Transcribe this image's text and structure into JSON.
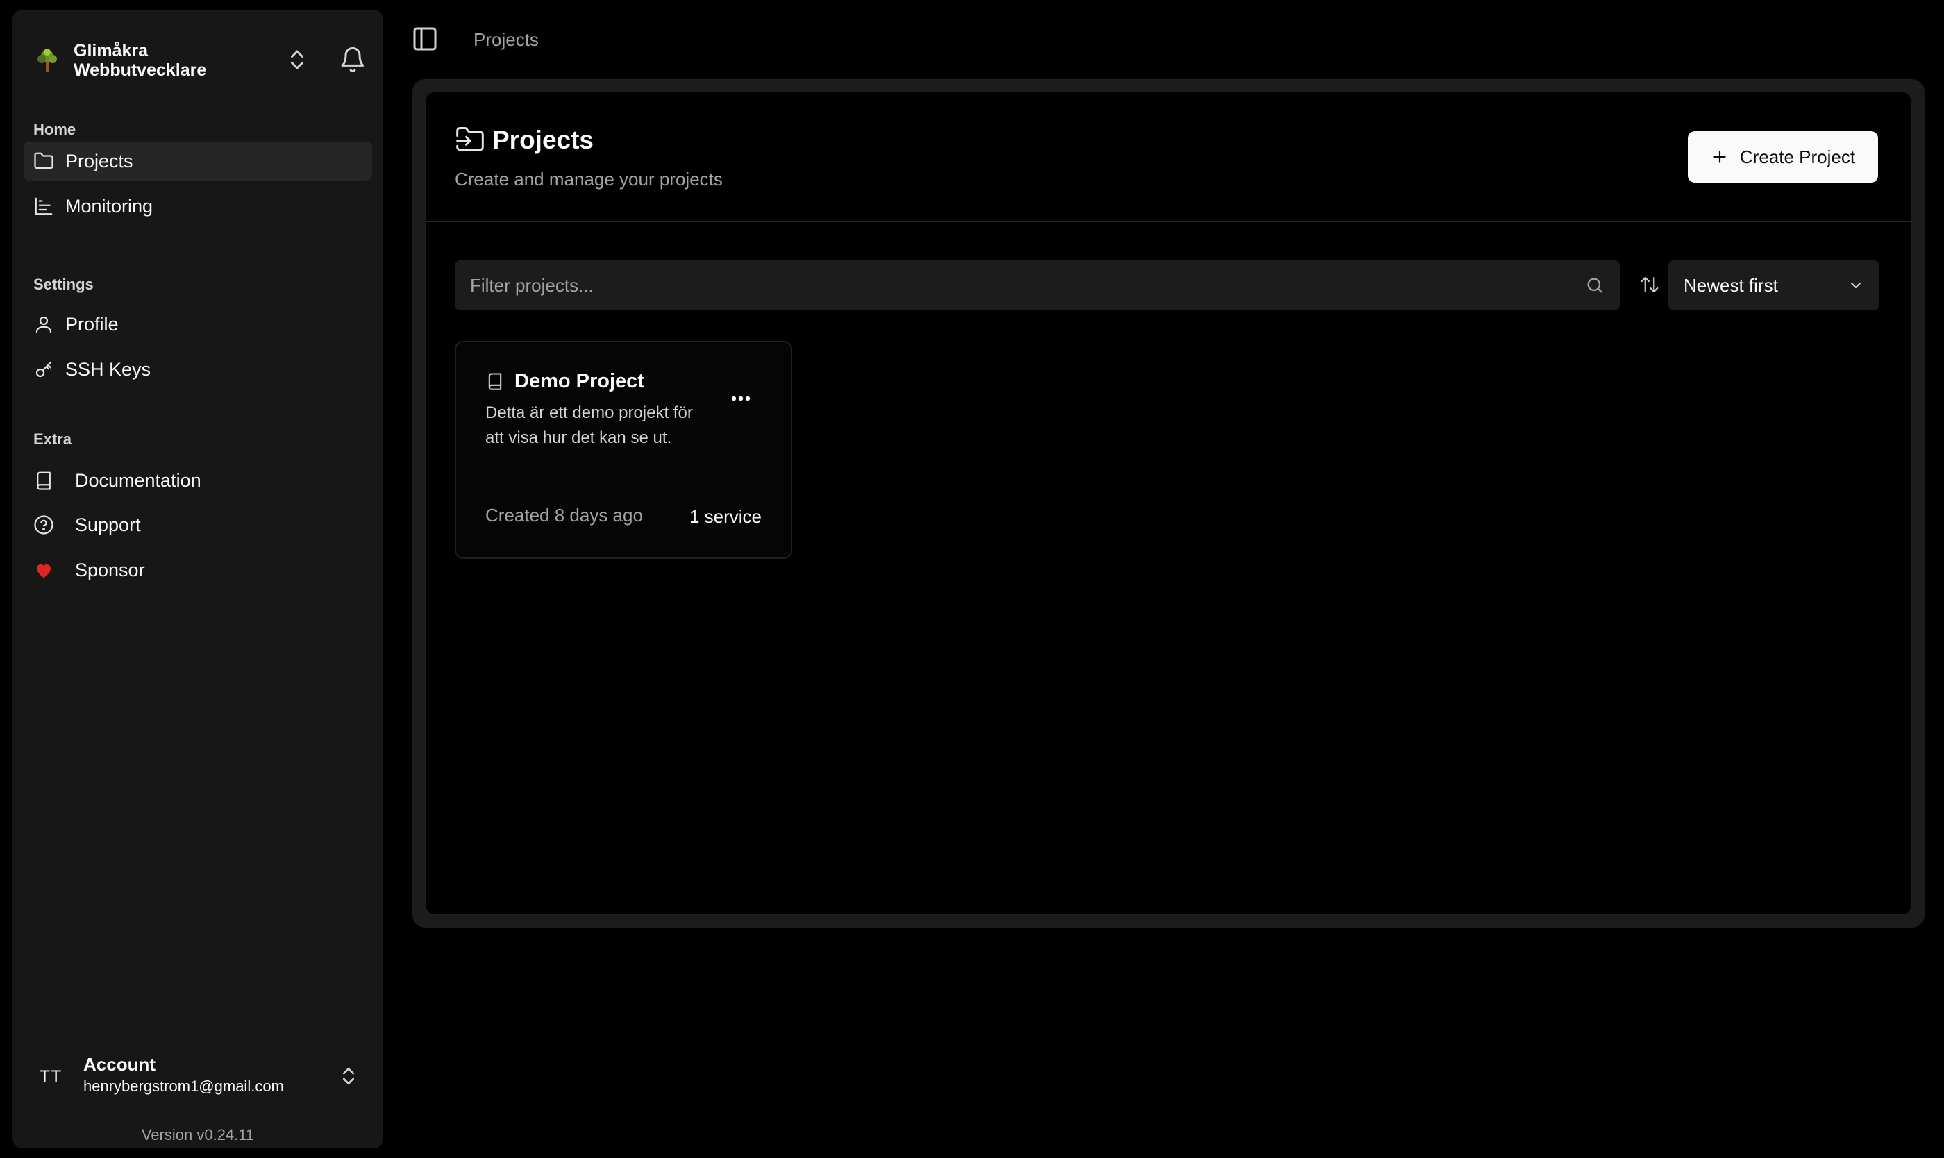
{
  "org": {
    "name": "Glimåkra Webbutvecklare"
  },
  "sidebar": {
    "groups": [
      {
        "label": "Home"
      },
      {
        "label": "Settings"
      },
      {
        "label": "Extra"
      }
    ],
    "items": [
      {
        "label": "Projects",
        "icon": "folder-icon",
        "active": true
      },
      {
        "label": "Monitoring",
        "icon": "monitoring-icon"
      },
      {
        "label": "Profile",
        "icon": "user-icon"
      },
      {
        "label": "SSH Keys",
        "icon": "key-icon"
      },
      {
        "label": "Documentation",
        "icon": "book-icon"
      },
      {
        "label": "Support",
        "icon": "help-circle-icon"
      },
      {
        "label": "Sponsor",
        "icon": "heart-icon",
        "color": "#dc2626"
      }
    ]
  },
  "account": {
    "initials": "TT",
    "label": "Account",
    "email": "henrybergstrom1@gmail.com"
  },
  "version": "Version v0.24.11",
  "breadcrumb": {
    "current": "Projects"
  },
  "page": {
    "title": "Projects",
    "subtitle": "Create and manage your projects",
    "create_label": "Create Project"
  },
  "filter": {
    "placeholder": "Filter projects..."
  },
  "sort": {
    "selected": "Newest first"
  },
  "projects": [
    {
      "name": "Demo Project",
      "description": "Detta är ett demo projekt för att visa hur det kan se ut.",
      "created": "Created 8 days ago",
      "services": "1 service"
    }
  ],
  "colors": {
    "background": "#000000",
    "sidebar": "#171717",
    "accent_button": "#fafafa",
    "heart": "#dc2626"
  }
}
